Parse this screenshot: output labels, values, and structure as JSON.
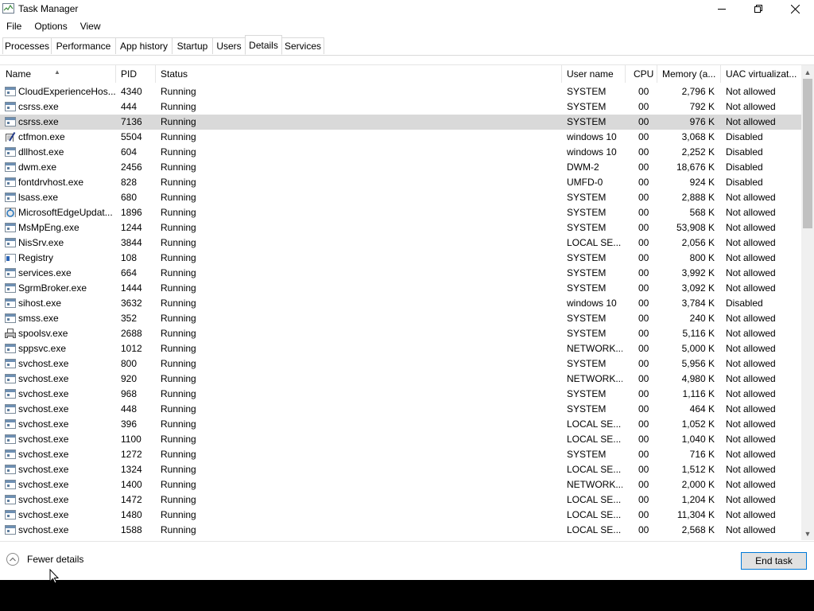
{
  "window": {
    "title": "Task Manager"
  },
  "menu": [
    "File",
    "Options",
    "View"
  ],
  "tabs": [
    "Processes",
    "Performance",
    "App history",
    "Startup",
    "Users",
    "Details",
    "Services"
  ],
  "active_tab": "Details",
  "columns": {
    "name": "Name",
    "pid": "PID",
    "status": "Status",
    "user": "User name",
    "cpu": "CPU",
    "memory": "Memory (a...",
    "uac": "UAC virtualizat..."
  },
  "selected_row_index": 2,
  "rows": [
    {
      "name": "CloudExperienceHos...",
      "pid": "4340",
      "status": "Running",
      "user": "SYSTEM",
      "cpu": "00",
      "memory": "2,796 K",
      "uac": "Not allowed",
      "icon": "process-icon"
    },
    {
      "name": "csrss.exe",
      "pid": "444",
      "status": "Running",
      "user": "SYSTEM",
      "cpu": "00",
      "memory": "792 K",
      "uac": "Not allowed",
      "icon": "process-icon"
    },
    {
      "name": "csrss.exe",
      "pid": "7136",
      "status": "Running",
      "user": "SYSTEM",
      "cpu": "00",
      "memory": "976 K",
      "uac": "Not allowed",
      "icon": "process-icon"
    },
    {
      "name": "ctfmon.exe",
      "pid": "5504",
      "status": "Running",
      "user": "windows 10",
      "cpu": "00",
      "memory": "3,068 K",
      "uac": "Disabled",
      "icon": "notepad-pen-icon"
    },
    {
      "name": "dllhost.exe",
      "pid": "604",
      "status": "Running",
      "user": "windows 10",
      "cpu": "00",
      "memory": "2,252 K",
      "uac": "Disabled",
      "icon": "process-icon"
    },
    {
      "name": "dwm.exe",
      "pid": "2456",
      "status": "Running",
      "user": "DWM-2",
      "cpu": "00",
      "memory": "18,676 K",
      "uac": "Disabled",
      "icon": "process-icon"
    },
    {
      "name": "fontdrvhost.exe",
      "pid": "828",
      "status": "Running",
      "user": "UMFD-0",
      "cpu": "00",
      "memory": "924 K",
      "uac": "Disabled",
      "icon": "process-icon"
    },
    {
      "name": "lsass.exe",
      "pid": "680",
      "status": "Running",
      "user": "SYSTEM",
      "cpu": "00",
      "memory": "2,888 K",
      "uac": "Not allowed",
      "icon": "process-icon"
    },
    {
      "name": "MicrosoftEdgeUpdat...",
      "pid": "1896",
      "status": "Running",
      "user": "SYSTEM",
      "cpu": "00",
      "memory": "568 K",
      "uac": "Not allowed",
      "icon": "edge-update-icon"
    },
    {
      "name": "MsMpEng.exe",
      "pid": "1244",
      "status": "Running",
      "user": "SYSTEM",
      "cpu": "00",
      "memory": "53,908 K",
      "uac": "Not allowed",
      "icon": "process-icon"
    },
    {
      "name": "NisSrv.exe",
      "pid": "3844",
      "status": "Running",
      "user": "LOCAL SE...",
      "cpu": "00",
      "memory": "2,056 K",
      "uac": "Not allowed",
      "icon": "process-icon"
    },
    {
      "name": "Registry",
      "pid": "108",
      "status": "Running",
      "user": "SYSTEM",
      "cpu": "00",
      "memory": "800 K",
      "uac": "Not allowed",
      "icon": "registry-icon"
    },
    {
      "name": "services.exe",
      "pid": "664",
      "status": "Running",
      "user": "SYSTEM",
      "cpu": "00",
      "memory": "3,992 K",
      "uac": "Not allowed",
      "icon": "process-icon"
    },
    {
      "name": "SgrmBroker.exe",
      "pid": "1444",
      "status": "Running",
      "user": "SYSTEM",
      "cpu": "00",
      "memory": "3,092 K",
      "uac": "Not allowed",
      "icon": "process-icon"
    },
    {
      "name": "sihost.exe",
      "pid": "3632",
      "status": "Running",
      "user": "windows 10",
      "cpu": "00",
      "memory": "3,784 K",
      "uac": "Disabled",
      "icon": "process-icon"
    },
    {
      "name": "smss.exe",
      "pid": "352",
      "status": "Running",
      "user": "SYSTEM",
      "cpu": "00",
      "memory": "240 K",
      "uac": "Not allowed",
      "icon": "process-icon"
    },
    {
      "name": "spoolsv.exe",
      "pid": "2688",
      "status": "Running",
      "user": "SYSTEM",
      "cpu": "00",
      "memory": "5,116 K",
      "uac": "Not allowed",
      "icon": "printer-icon"
    },
    {
      "name": "sppsvc.exe",
      "pid": "1012",
      "status": "Running",
      "user": "NETWORK...",
      "cpu": "00",
      "memory": "5,000 K",
      "uac": "Not allowed",
      "icon": "process-icon"
    },
    {
      "name": "svchost.exe",
      "pid": "800",
      "status": "Running",
      "user": "SYSTEM",
      "cpu": "00",
      "memory": "5,956 K",
      "uac": "Not allowed",
      "icon": "process-icon"
    },
    {
      "name": "svchost.exe",
      "pid": "920",
      "status": "Running",
      "user": "NETWORK...",
      "cpu": "00",
      "memory": "4,980 K",
      "uac": "Not allowed",
      "icon": "process-icon"
    },
    {
      "name": "svchost.exe",
      "pid": "968",
      "status": "Running",
      "user": "SYSTEM",
      "cpu": "00",
      "memory": "1,116 K",
      "uac": "Not allowed",
      "icon": "process-icon"
    },
    {
      "name": "svchost.exe",
      "pid": "448",
      "status": "Running",
      "user": "SYSTEM",
      "cpu": "00",
      "memory": "464 K",
      "uac": "Not allowed",
      "icon": "process-icon"
    },
    {
      "name": "svchost.exe",
      "pid": "396",
      "status": "Running",
      "user": "LOCAL SE...",
      "cpu": "00",
      "memory": "1,052 K",
      "uac": "Not allowed",
      "icon": "process-icon"
    },
    {
      "name": "svchost.exe",
      "pid": "1100",
      "status": "Running",
      "user": "LOCAL SE...",
      "cpu": "00",
      "memory": "1,040 K",
      "uac": "Not allowed",
      "icon": "process-icon"
    },
    {
      "name": "svchost.exe",
      "pid": "1272",
      "status": "Running",
      "user": "SYSTEM",
      "cpu": "00",
      "memory": "716 K",
      "uac": "Not allowed",
      "icon": "process-icon"
    },
    {
      "name": "svchost.exe",
      "pid": "1324",
      "status": "Running",
      "user": "LOCAL SE...",
      "cpu": "00",
      "memory": "1,512 K",
      "uac": "Not allowed",
      "icon": "process-icon"
    },
    {
      "name": "svchost.exe",
      "pid": "1400",
      "status": "Running",
      "user": "NETWORK...",
      "cpu": "00",
      "memory": "2,000 K",
      "uac": "Not allowed",
      "icon": "process-icon"
    },
    {
      "name": "svchost.exe",
      "pid": "1472",
      "status": "Running",
      "user": "LOCAL SE...",
      "cpu": "00",
      "memory": "1,204 K",
      "uac": "Not allowed",
      "icon": "process-icon"
    },
    {
      "name": "svchost.exe",
      "pid": "1480",
      "status": "Running",
      "user": "LOCAL SE...",
      "cpu": "00",
      "memory": "11,304 K",
      "uac": "Not allowed",
      "icon": "process-icon"
    },
    {
      "name": "svchost.exe",
      "pid": "1588",
      "status": "Running",
      "user": "LOCAL SE...",
      "cpu": "00",
      "memory": "2,568 K",
      "uac": "Not allowed",
      "icon": "process-icon"
    }
  ],
  "footer": {
    "fewer_details": "Fewer details",
    "end_task": "End task"
  },
  "colors": {
    "selected_row": "#d9d9d9",
    "end_task_border": "#0078d7",
    "scroll_thumb": "#c1c1c1"
  }
}
